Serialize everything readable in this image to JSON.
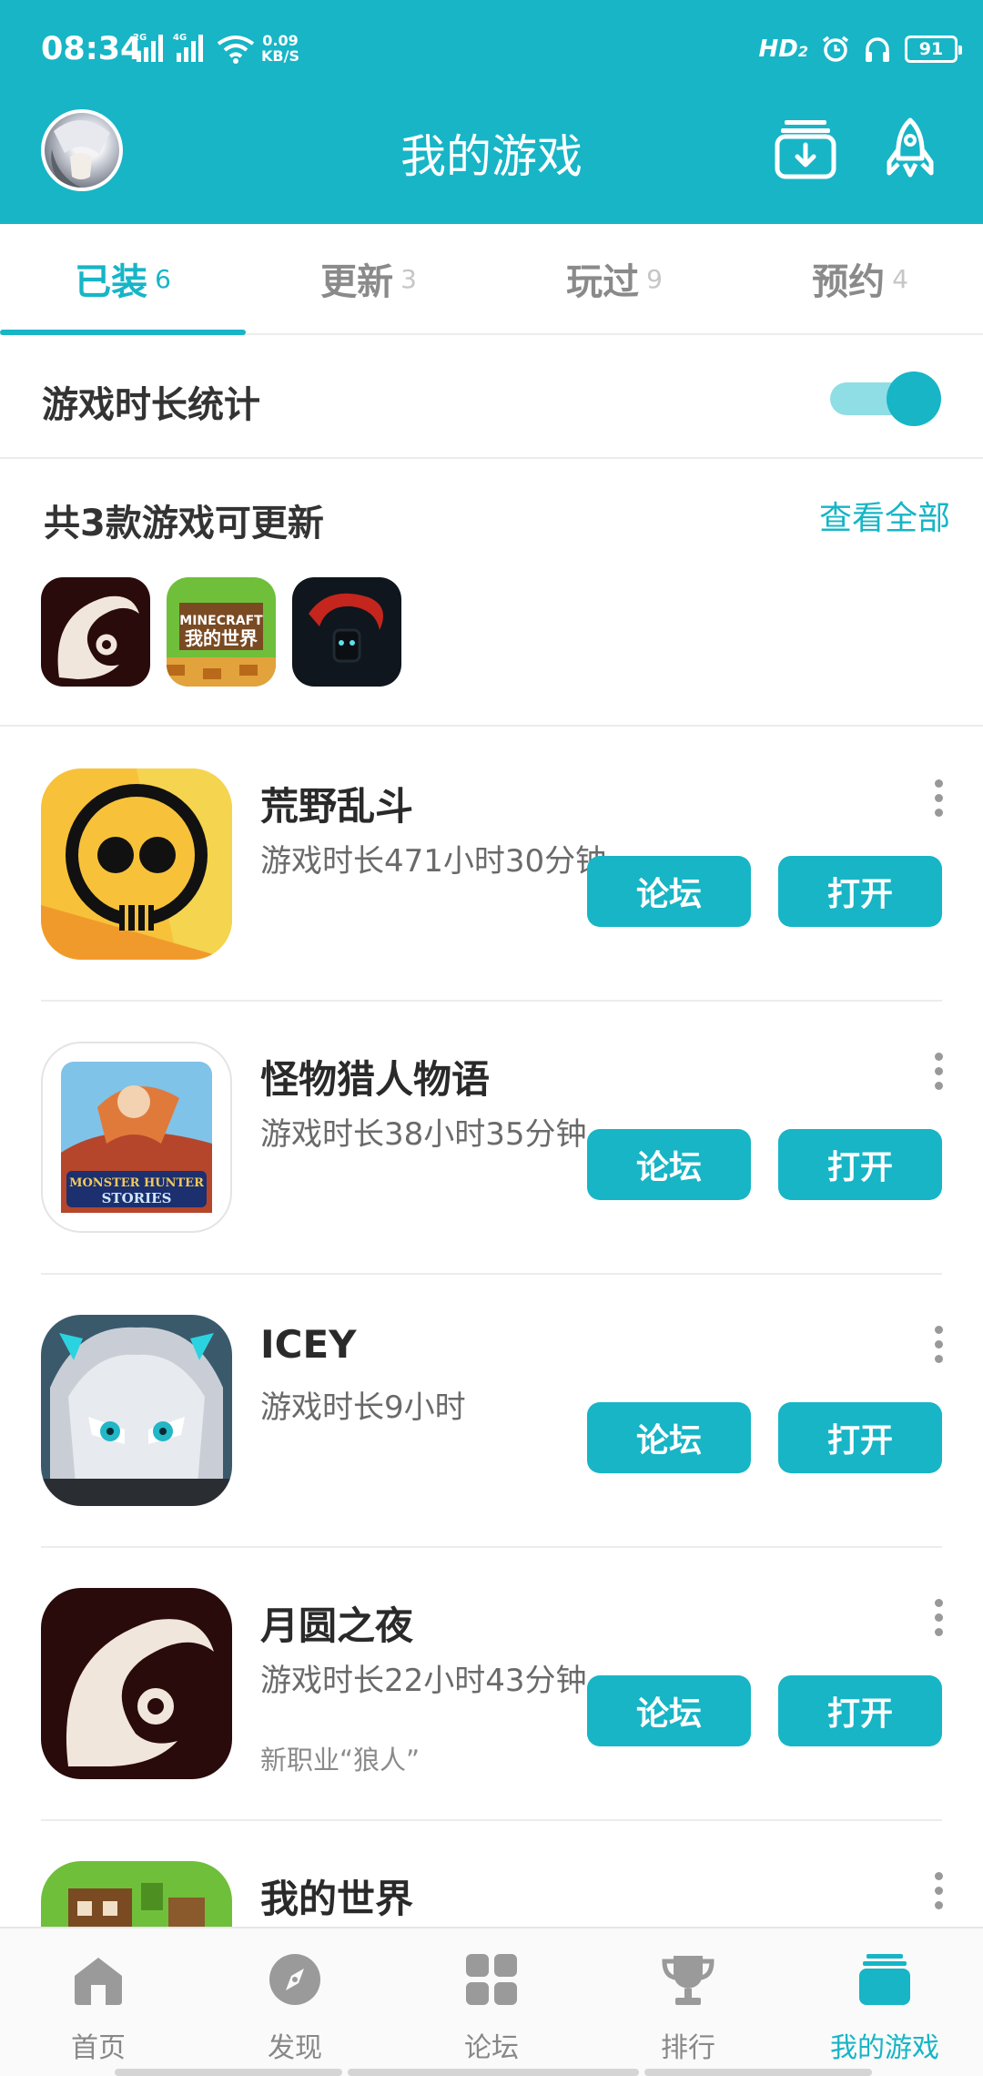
{
  "status_bar": {
    "time": "08:34",
    "net_speed_value": "0.09",
    "net_speed_unit": "KB/S",
    "hd_label": "HD",
    "hd_sub": "2",
    "battery": "91"
  },
  "header": {
    "title": "我的游戏"
  },
  "tabs": [
    {
      "label": "已装",
      "count": "6"
    },
    {
      "label": "更新",
      "count": "3"
    },
    {
      "label": "玩过",
      "count": "9"
    },
    {
      "label": "预约",
      "count": "4"
    }
  ],
  "playtime_stats": {
    "label": "游戏时长统计",
    "enabled": true
  },
  "updates": {
    "title": "共3款游戏可更新",
    "view_all": "查看全部",
    "icons": [
      "moon-night-game-icon",
      "minecraft-game-icon",
      "dark-creature-game-icon"
    ]
  },
  "games": [
    {
      "name": "荒野乱斗",
      "playtime": "游戏时长471小时30分钟",
      "note": "",
      "forum": "论坛",
      "open": "打开"
    },
    {
      "name": "怪物猎人物语",
      "playtime": "游戏时长38小时35分钟",
      "note": "",
      "forum": "论坛",
      "open": "打开"
    },
    {
      "name": "ICEY",
      "playtime": "游戏时长9小时",
      "note": "",
      "forum": "论坛",
      "open": "打开"
    },
    {
      "name": "月圆之夜",
      "playtime": "游戏时长22小时43分钟",
      "note": "新职业“狼人”",
      "forum": "论坛",
      "open": "打开"
    },
    {
      "name": "我的世界",
      "playtime": "",
      "note": "",
      "forum": "",
      "open": ""
    }
  ],
  "bottom_nav": [
    {
      "label": "首页",
      "icon": "home-icon"
    },
    {
      "label": "发现",
      "icon": "compass-icon"
    },
    {
      "label": "论坛",
      "icon": "grid-icon"
    },
    {
      "label": "排行",
      "icon": "trophy-icon"
    },
    {
      "label": "我的游戏",
      "icon": "my-games-icon",
      "active": true
    }
  ],
  "colors": {
    "accent": "#17b5c6",
    "accent_light": "#8fdde5",
    "text": "#333333",
    "muted": "#8a8a8a"
  }
}
